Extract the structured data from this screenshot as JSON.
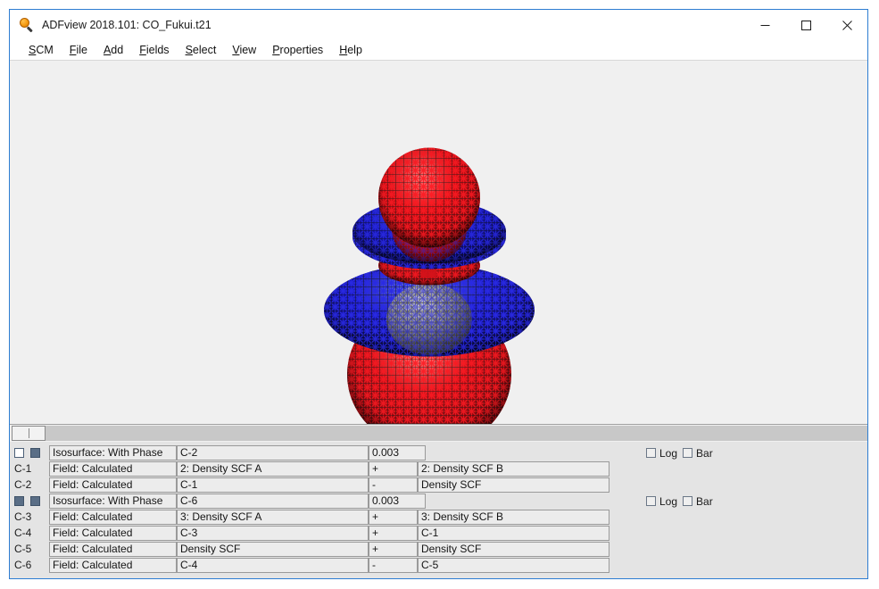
{
  "window": {
    "title": "ADFview 2018.101: CO_Fukui.t21",
    "icon": "magnifier-icon",
    "border_color": "#2d7dd2",
    "controls": [
      {
        "name": "minimize",
        "glyph": "minimize-icon"
      },
      {
        "name": "maximize",
        "glyph": "maximize-icon"
      },
      {
        "name": "close",
        "glyph": "close-icon"
      }
    ]
  },
  "menubar": {
    "items": [
      {
        "label": "SCM",
        "accel": "S"
      },
      {
        "label": "File",
        "accel": "F"
      },
      {
        "label": "Add",
        "accel": "A"
      },
      {
        "label": "Fields",
        "accel": "F"
      },
      {
        "label": "Select",
        "accel": "S"
      },
      {
        "label": "View",
        "accel": "V"
      },
      {
        "label": "Properties",
        "accel": "P"
      },
      {
        "label": "Help",
        "accel": "H"
      }
    ]
  },
  "viewport": {
    "name": "3d-molecular-orbital-view",
    "background": "#f0f0f0",
    "positive_lobe_color": "#e8000a",
    "negative_lobe_color": "#1818c8",
    "render_mode": "wireframe-isosurface"
  },
  "splitter": {
    "name": "horizontal-splitter"
  },
  "panel": {
    "groups": [
      {
        "name": "isosurface-group-1",
        "header": {
          "visible_checked": false,
          "second_checked": true,
          "type": "Isosurface: With Phase",
          "field": "C-2",
          "isovalue": "0.003",
          "log_label": "Log",
          "log_checked": false,
          "bar_label": "Bar",
          "bar_checked": false
        },
        "fields": [
          {
            "id": "C-1",
            "type": "Field: Calculated",
            "operand1": "2: Density SCF A",
            "operator": "+",
            "operand2": "2: Density SCF B"
          },
          {
            "id": "C-2",
            "type": "Field: Calculated",
            "operand1": "C-1",
            "operator": "-",
            "operand2": "Density SCF"
          }
        ]
      },
      {
        "name": "isosurface-group-2",
        "header": {
          "visible_checked": true,
          "second_checked": true,
          "type": "Isosurface: With Phase",
          "field": "C-6",
          "isovalue": "0.003",
          "log_label": "Log",
          "log_checked": false,
          "bar_label": "Bar",
          "bar_checked": false
        },
        "fields": [
          {
            "id": "C-3",
            "type": "Field: Calculated",
            "operand1": "3: Density SCF A",
            "operator": "+",
            "operand2": "3: Density SCF B"
          },
          {
            "id": "C-4",
            "type": "Field: Calculated",
            "operand1": "C-3",
            "operator": "+",
            "operand2": "C-1"
          },
          {
            "id": "C-5",
            "type": "Field: Calculated",
            "operand1": "Density SCF",
            "operator": "+",
            "operand2": "Density SCF"
          },
          {
            "id": "C-6",
            "type": "Field: Calculated",
            "operand1": "C-4",
            "operator": "-",
            "operand2": "C-5"
          }
        ]
      }
    ]
  }
}
